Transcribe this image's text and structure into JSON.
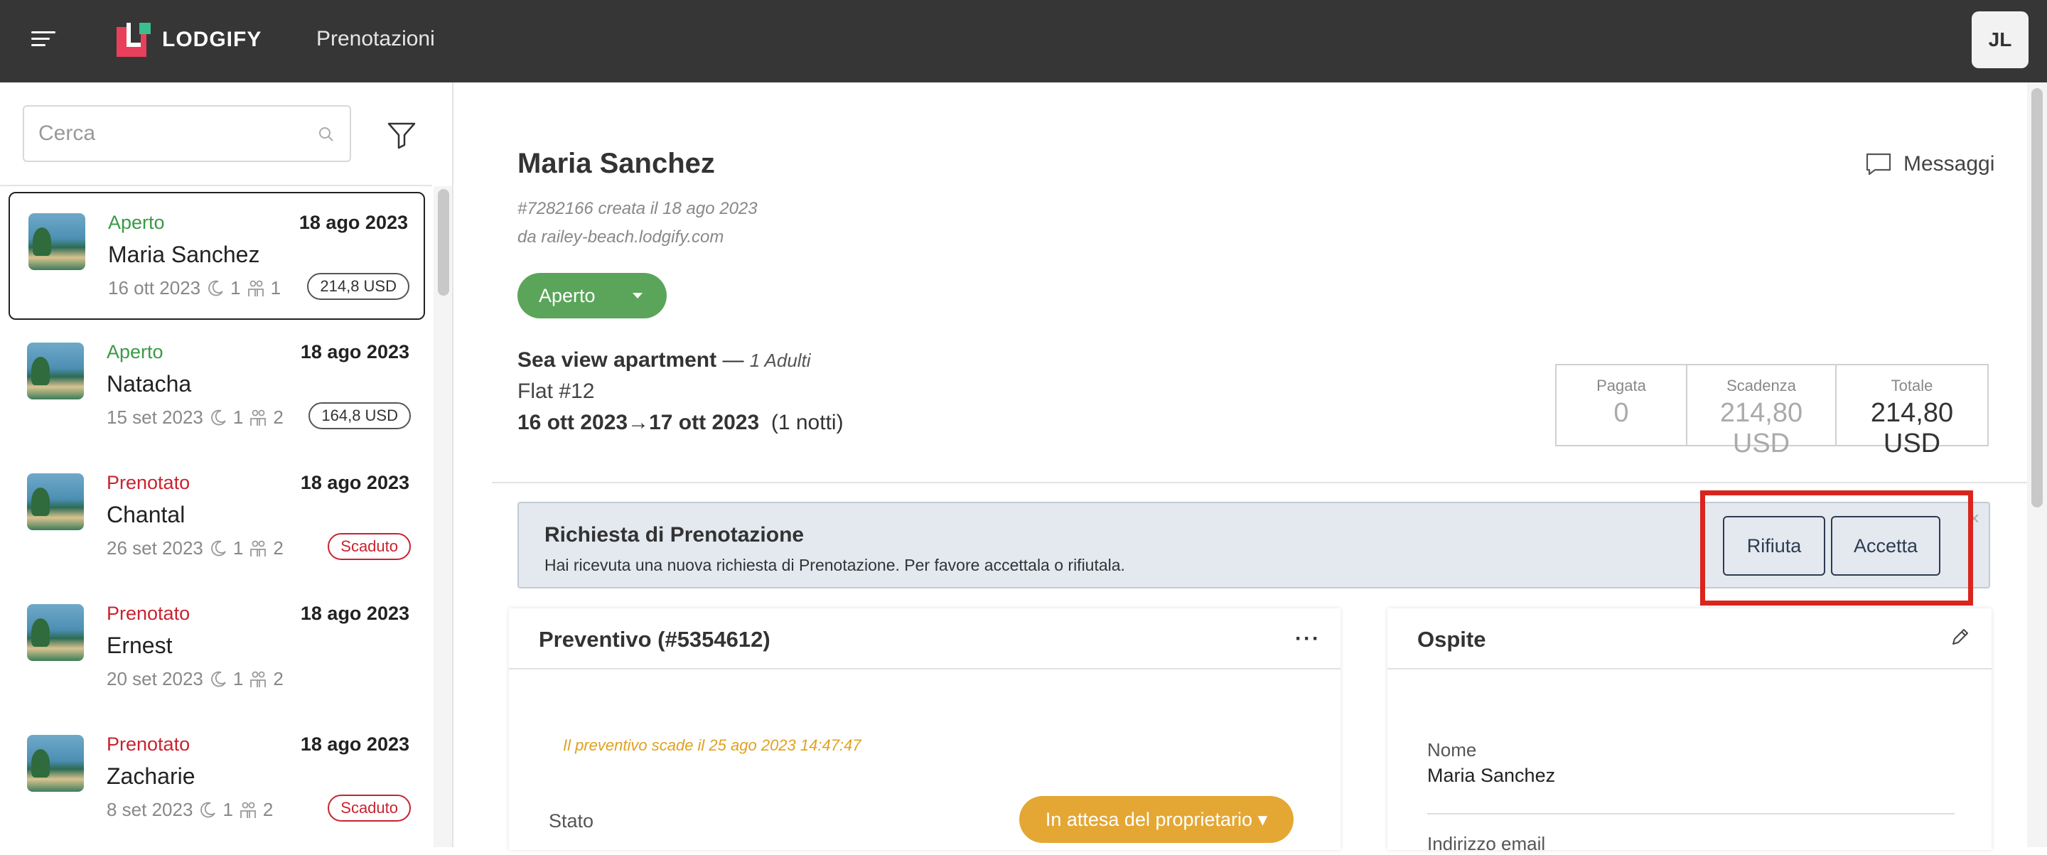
{
  "header": {
    "brand": "LODGIFY",
    "title": "Prenotazioni",
    "user_initials": "JL"
  },
  "sidebar": {
    "search_placeholder": "Cerca",
    "bookings": [
      {
        "status": "Aperto",
        "status_color": "#3a9a45",
        "name": "Maria Sanchez",
        "created": "18 ago 2023",
        "checkin": "16 ott 2023",
        "nights": "1",
        "guests": "1",
        "badge": "214,8 USD",
        "badge_type": "price",
        "selected": true
      },
      {
        "status": "Aperto",
        "status_color": "#3a9a45",
        "name": "Natacha",
        "created": "18 ago 2023",
        "checkin": "15 set 2023",
        "nights": "1",
        "guests": "2",
        "badge": "164,8 USD",
        "badge_type": "price",
        "selected": false
      },
      {
        "status": "Prenotato",
        "status_color": "#c9232f",
        "name": "Chantal",
        "created": "18 ago 2023",
        "checkin": "26 set 2023",
        "nights": "1",
        "guests": "2",
        "badge": "Scaduto",
        "badge_type": "expired",
        "selected": false
      },
      {
        "status": "Prenotato",
        "status_color": "#c9232f",
        "name": "Ernest",
        "created": "18 ago 2023",
        "checkin": "20 set 2023",
        "nights": "1",
        "guests": "2",
        "badge": "",
        "badge_type": "none",
        "selected": false
      },
      {
        "status": "Prenotato",
        "status_color": "#c9232f",
        "name": "Zacharie",
        "created": "18 ago 2023",
        "checkin": "8 set 2023",
        "nights": "1",
        "guests": "2",
        "badge": "Scaduto",
        "badge_type": "expired",
        "selected": false
      }
    ]
  },
  "detail": {
    "guest_name": "Maria Sanchez",
    "messages_label": "Messaggi",
    "booking_id": "#7282166 creata il 18 ago 2023",
    "source": "da railey-beach.lodgify.com",
    "status": "Aperto",
    "property_name": "Sea view apartment",
    "property_suffix": " — ",
    "adults": "1 Adulti",
    "unit": "Flat #12",
    "date_from": "16 ott 2023",
    "arrow": "→",
    "date_to": "17 ott 2023",
    "nights": "(1 notti)",
    "payment": {
      "paid_label": "Pagata",
      "paid_value": "0",
      "due_label": "Scadenza",
      "due_value": "214,80 USD",
      "total_label": "Totale",
      "total_value": "214,80 USD"
    },
    "request": {
      "title": "Richiesta di Prenotazione",
      "text": "Hai ricevuta una nuova richiesta di Prenotazione. Per favore accettala o rifiutala.",
      "reject_label": "Rifiuta",
      "accept_label": "Accetta",
      "highlight_color": "#d9251d"
    },
    "quote": {
      "title": "Preventivo (#5354612)",
      "menu": "···",
      "expiry": "Il preventivo scade il 25 ago 2023 14:47:47",
      "state_label": "Stato",
      "state_value": "In attesa del proprietario"
    },
    "guest_card": {
      "title": "Ospite",
      "name_label": "Nome",
      "name_value": "Maria Sanchez",
      "email_label": "Indirizzo email"
    }
  }
}
